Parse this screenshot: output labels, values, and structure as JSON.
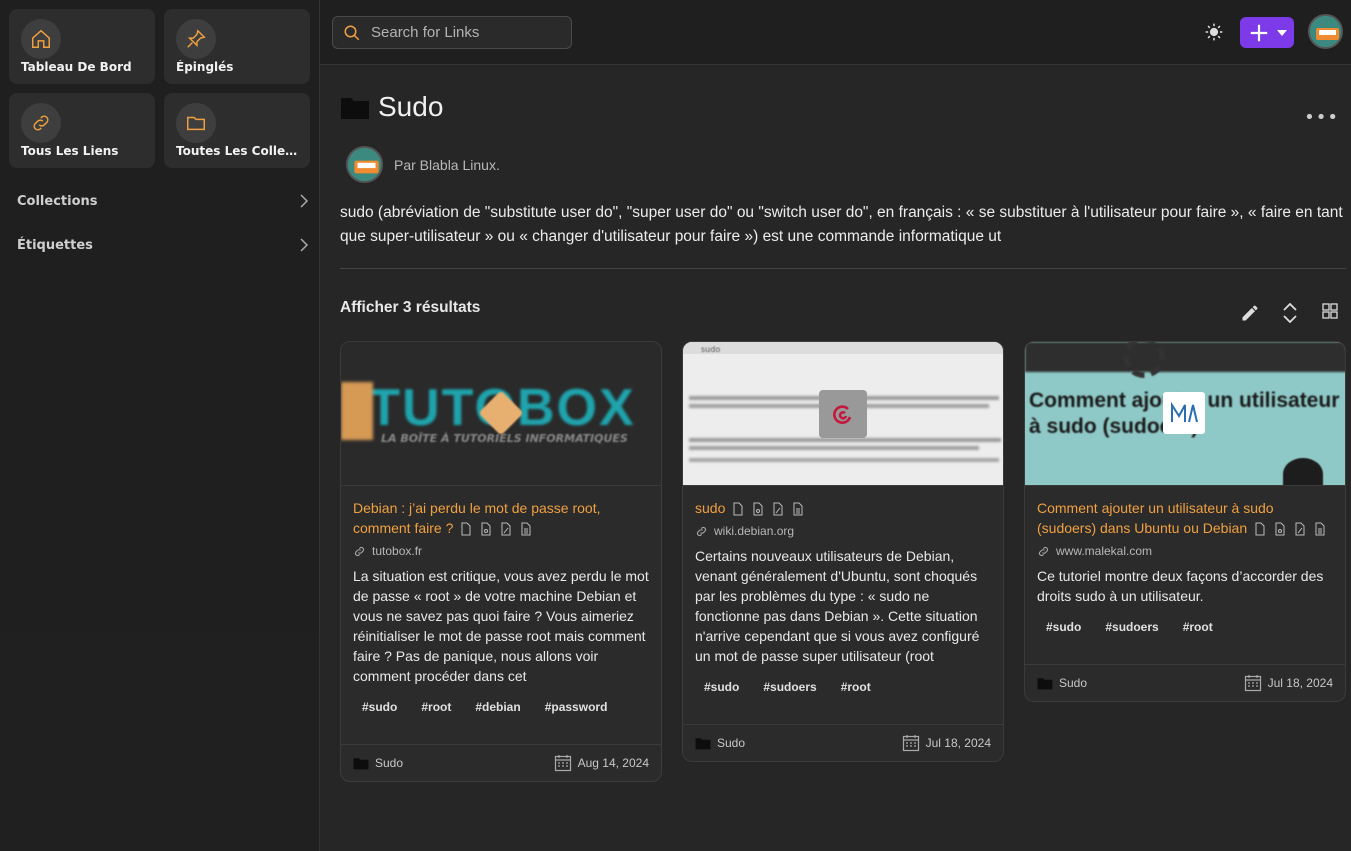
{
  "sidebar": {
    "tiles": [
      {
        "label": "Tableau De Bord",
        "icon": "home-icon"
      },
      {
        "label": "Épinglés",
        "icon": "pin-icon"
      },
      {
        "label": "Tous Les Liens",
        "icon": "link-icon"
      },
      {
        "label": "Toutes Les Collections",
        "icon": "folder-icon"
      }
    ],
    "sections": [
      {
        "label": "Collections"
      },
      {
        "label": "Étiquettes"
      }
    ]
  },
  "topbar": {
    "search_placeholder": "Search for Links"
  },
  "collection": {
    "name": "Sudo",
    "author": "Par Blabla Linux.",
    "description": "sudo (abréviation de \"substitute user do\", \"super user do\" ou \"switch user do\", en français : « se substituer à l'utilisateur pour faire », « faire en tant que super-utilisateur » ou « changer d'utilisateur pour faire ») est une commande informatique ut",
    "results": "Afficher 3 résultats"
  },
  "cards": [
    {
      "thumb_text": "TUTOBOX",
      "thumb_sub": "LA BOÎTE À TUTORIELS INFORMATIQUES",
      "title": "Debian : j’ai perdu le mot de passe root, comment faire ?",
      "url": "tutobox.fr",
      "desc": "La situation est critique, vous avez perdu le mot de passe « root » de votre machine Debian et vous ne savez pas quoi faire ? Vous aimeriez réinitialiser le mot de passe root mais comment faire ? Pas de panique, nous allons voir comment procéder dans cet",
      "tags": [
        "#sudo",
        "#root",
        "#debian",
        "#password"
      ],
      "collection": "Sudo",
      "date": "Aug 14, 2024"
    },
    {
      "thumb_text": "sudo",
      "title": "sudo",
      "url": "wiki.debian.org",
      "desc": "Certains nouveaux utilisateurs de Debian, venant généralement d'Ubuntu, sont choqués par les problèmes du type : « sudo ne fonctionne pas dans Debian ». Cette situation n'arrive cependant que si vous avez configuré un mot de passe super utilisateur (root",
      "tags": [
        "#sudo",
        "#sudoers",
        "#root"
      ],
      "collection": "Sudo",
      "date": "Jul 18, 2024"
    },
    {
      "thumb_text": "Comment ajouter un utilisateur à sudo (sudoers)",
      "title": "Comment ajouter un utilisateur à sudo (sudoers) dans Ubuntu ou Debian",
      "url": "www.malekal.com",
      "desc": "Ce tutoriel montre deux façons d’accorder des droits sudo à un utilisateur.",
      "tags": [
        "#sudo",
        "#sudoers",
        "#root"
      ],
      "collection": "Sudo",
      "date": "Jul 18, 2024"
    }
  ],
  "colors": {
    "accent": "#7c3ae8",
    "link_title": "#f0a040",
    "icon_orange": "#f0a040"
  }
}
